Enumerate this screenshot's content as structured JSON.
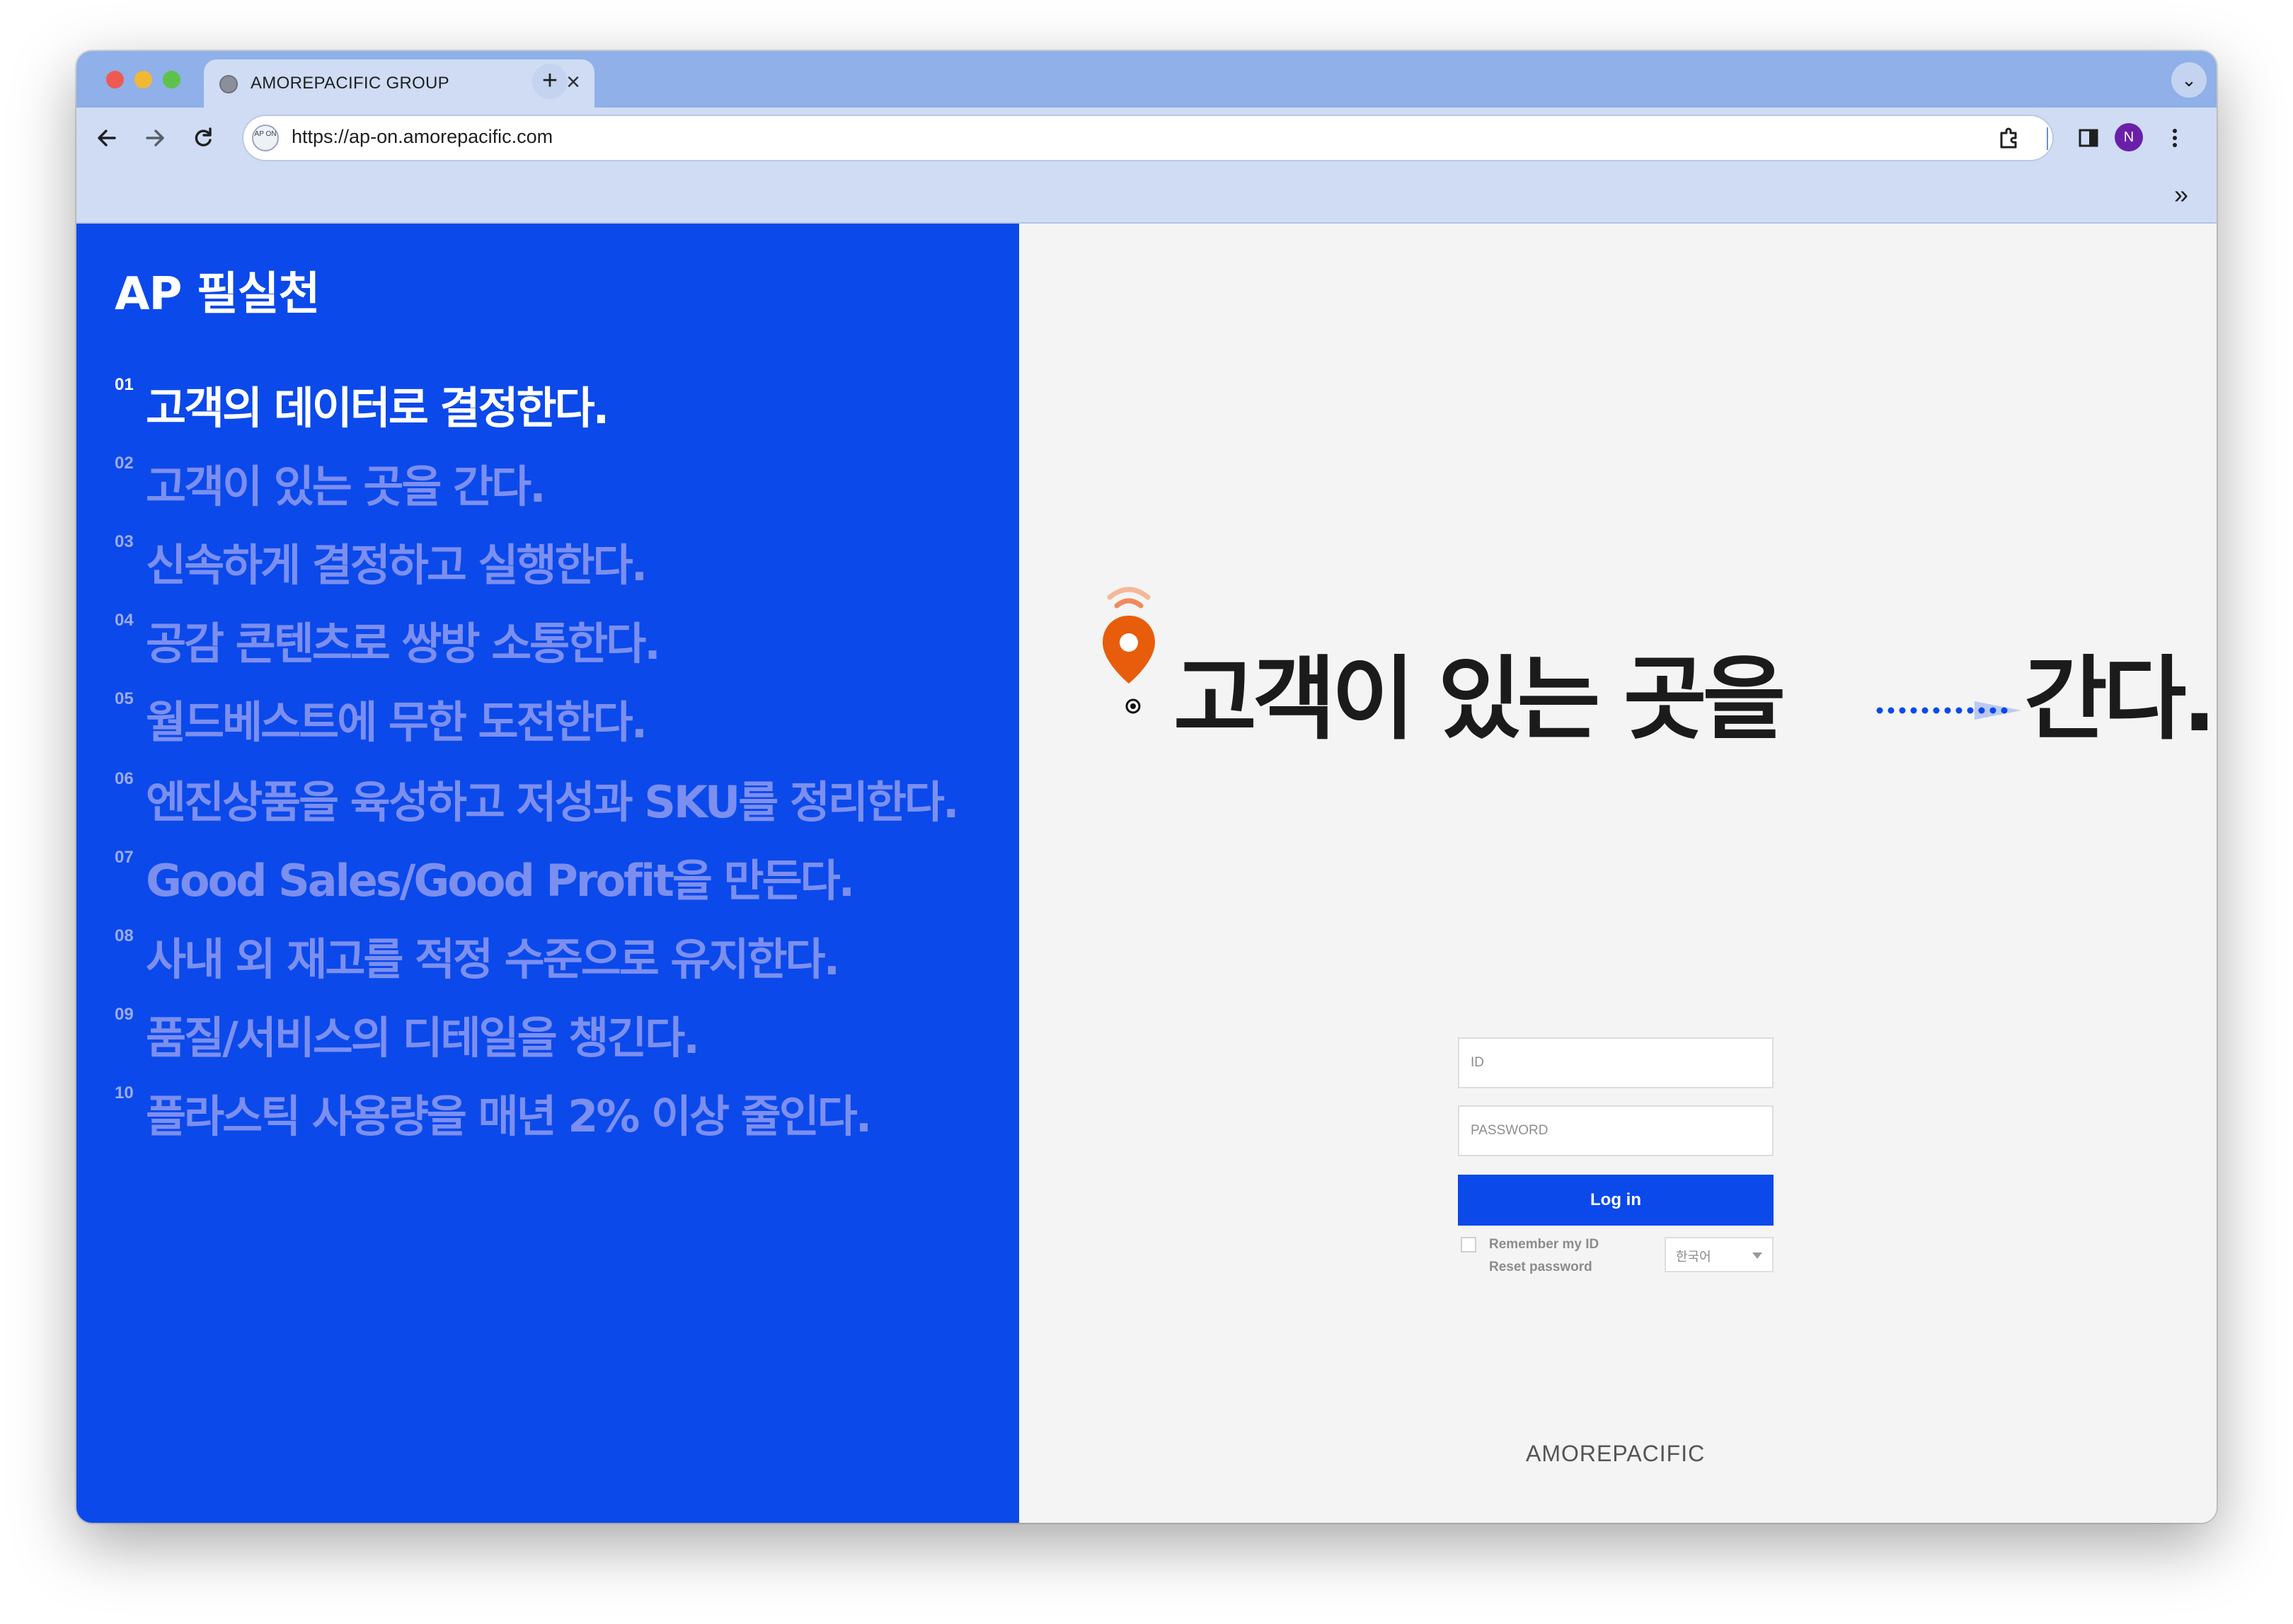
{
  "browser": {
    "tab_title": "AMOREPACIFIC GROUP",
    "tab_close": "×",
    "new_tab": "+",
    "tab_menu": "⌄",
    "url": "https://ap-on.amorepacific.com",
    "site_icon_text": "AP ON",
    "profile_initial": "N",
    "bookmarks_overflow": "»",
    "icons": [
      "back-arrow-icon",
      "forward-arrow-icon",
      "reload-icon",
      "extensions-icon",
      "side-panel-icon",
      "kebab-menu-icon"
    ]
  },
  "left_panel": {
    "title": "AP 필실천",
    "bg_color": "#0b49ea",
    "principles": [
      {
        "num": "01",
        "text": "고객의 데이터로 결정한다."
      },
      {
        "num": "02",
        "text": "고객이 있는 곳을 간다."
      },
      {
        "num": "03",
        "text": "신속하게 결정하고 실행한다."
      },
      {
        "num": "04",
        "text": "공감 콘텐츠로 쌍방 소통한다."
      },
      {
        "num": "05",
        "text": "월드베스트에 무한 도전한다."
      },
      {
        "num": "06",
        "text": "엔진상품을 육성하고 저성과 SKU를 정리한다."
      },
      {
        "num": "07",
        "text": "Good Sales/Good Profit을 만든다."
      },
      {
        "num": "08",
        "text": "사내 외 재고를 적정 수준으로 유지한다."
      },
      {
        "num": "09",
        "text": "품질/서비스의 디테일을 챙긴다."
      },
      {
        "num": "10",
        "text": "플라스틱 사용량을 매년 2% 이상 줄인다."
      }
    ]
  },
  "hero": {
    "slogan_part1": "고객이 있는 곳을",
    "slogan_part2": "간다.",
    "pin_color": "#e85d0c"
  },
  "login": {
    "id_placeholder": "ID",
    "password_placeholder": "PASSWORD",
    "login_label": "Log in",
    "remember_label": "Remember my ID",
    "reset_label": "Reset password",
    "language": "한국어",
    "button_color": "#0b49ea"
  },
  "footer": {
    "brand": "AMOREPACIFIC"
  }
}
